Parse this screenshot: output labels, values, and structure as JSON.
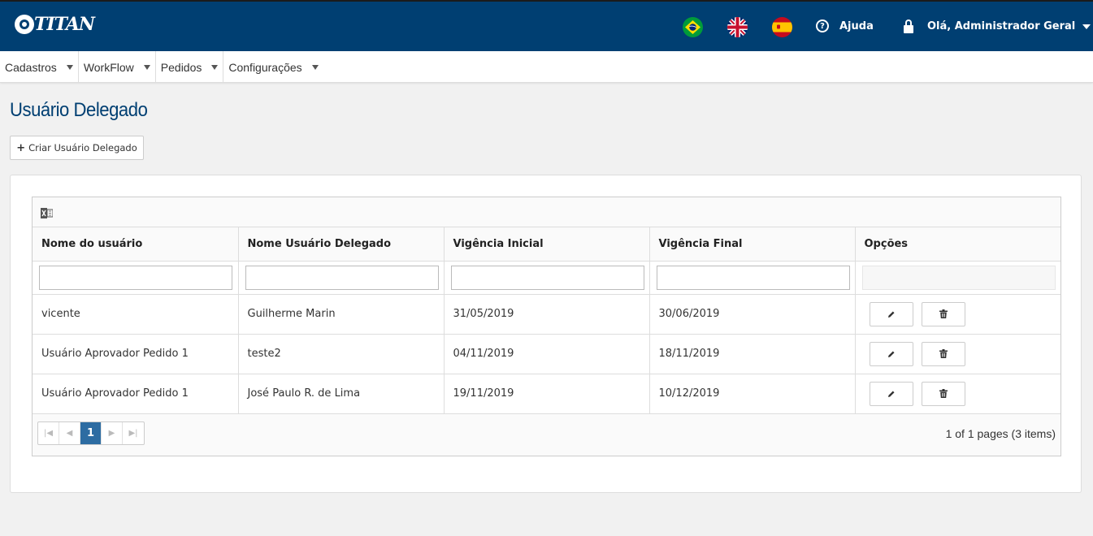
{
  "header": {
    "logo_text": "TITAN",
    "help_label": "Ajuda",
    "user_greeting": "Olá, Administrador Geral",
    "colors": {
      "header_bg": "#003f72",
      "accent": "#2d6ca2"
    },
    "flags": [
      "brazil-flag",
      "uk-flag",
      "spain-flag"
    ]
  },
  "menu": [
    {
      "label": "Cadastros"
    },
    {
      "label": "WorkFlow"
    },
    {
      "label": "Pedidos"
    },
    {
      "label": "Configurações"
    }
  ],
  "page": {
    "title": "Usuário Delegado",
    "create_button": "Criar Usuário Delegado"
  },
  "table": {
    "columns": [
      "Nome do usuário",
      "Nome Usuário Delegado",
      "Vigência Inicial",
      "Vigência Final",
      "Opções"
    ],
    "rows": [
      {
        "user": "vicente",
        "delegate": "Guilherme Marin",
        "start": "31/05/2019",
        "end": "30/06/2019"
      },
      {
        "user": "Usuário Aprovador Pedido 1",
        "delegate": "teste2",
        "start": "04/11/2019",
        "end": "18/11/2019"
      },
      {
        "user": "Usuário Aprovador Pedido 1",
        "delegate": "José Paulo R. de Lima",
        "start": "19/11/2019",
        "end": "10/12/2019"
      }
    ],
    "pager": {
      "current_page": "1",
      "info": "1 of 1 pages (3 items)"
    }
  }
}
